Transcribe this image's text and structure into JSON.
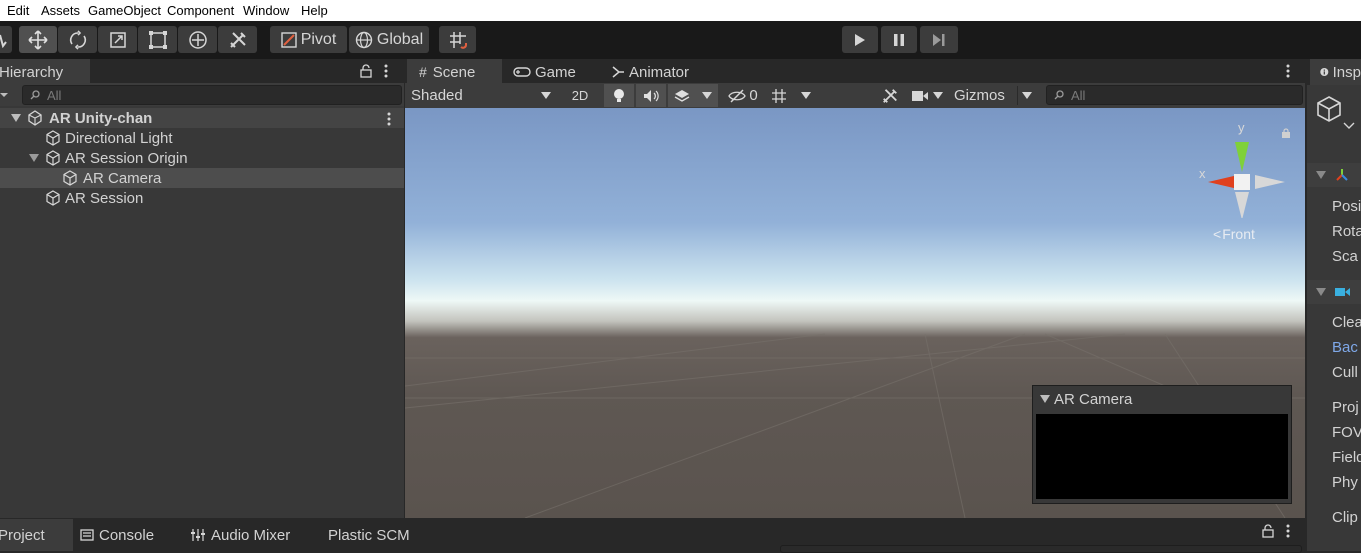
{
  "menu": [
    "Edit",
    "Assets",
    "GameObject",
    "Component",
    "Window",
    "Help"
  ],
  "toolbar": {
    "pivot_label": "Pivot",
    "global_label": "Global"
  },
  "hierarchy": {
    "tab_label": "Hierarchy",
    "search_placeholder": "All",
    "scene_name": "AR Unity-chan",
    "items": [
      {
        "label": "Directional Light"
      },
      {
        "label": "AR Session Origin"
      },
      {
        "label": "AR Camera"
      },
      {
        "label": "AR Session"
      }
    ]
  },
  "scene": {
    "tabs": [
      {
        "label": "Scene"
      },
      {
        "label": "Game"
      },
      {
        "label": "Animator"
      }
    ],
    "shading_mode": "Shaded",
    "mode_2d_label": "2D",
    "hidden_count": "0",
    "gizmos_label": "Gizmos",
    "search_placeholder": "All",
    "gizmo_y": "y",
    "gizmo_x": "x",
    "view_label": "Front",
    "preview_title": "AR Camera"
  },
  "inspector": {
    "tab_label": "Insp",
    "fields": [
      "Posi",
      "Rota",
      "Sca",
      "Clea",
      "Bac",
      "Cull",
      "Proj",
      "FOV",
      "Field",
      "Phy",
      "Clip"
    ]
  },
  "bottom": {
    "tabs": [
      {
        "label": "Project"
      },
      {
        "label": "Console"
      },
      {
        "label": "Audio Mixer"
      },
      {
        "label": "Plastic SCM"
      }
    ]
  },
  "colors": {
    "accent_link": "#7fa8e8",
    "gizmo_y": "#7fd13a",
    "gizmo_x": "#e0411e"
  }
}
